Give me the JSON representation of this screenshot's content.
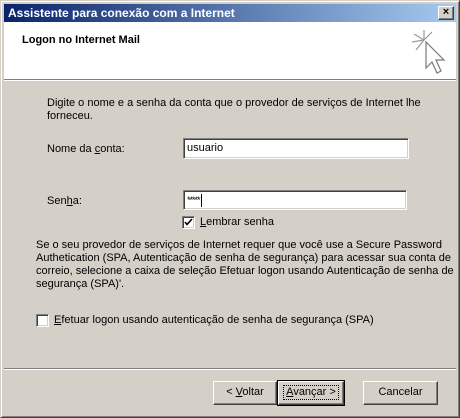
{
  "window": {
    "title": "Assistente para conexão com a Internet",
    "close_label": "×"
  },
  "header": {
    "title": "Logon no Internet Mail",
    "icon": "wizard-cursor-icon"
  },
  "intro_text": "Digite o nome e a senha da conta que o provedor de serviços de Internet lhe forneceu.",
  "account": {
    "label_before": "Nome da ",
    "label_accel": "c",
    "label_after": "onta:",
    "value": "usuario"
  },
  "password": {
    "label_before": "Sen",
    "label_accel": "h",
    "label_after": "a:",
    "mask": "*****"
  },
  "remember": {
    "accel": "L",
    "label_rest": "embrar senha",
    "checked": true
  },
  "spa_description": "Se o seu provedor de serviços de Internet requer que você use a Secure Password Authetication (SPA, Autenticação de senha de segurança) para acessar sua conta de correio, selecione a caixa de seleção Efetuar logon usando Autenticação de senha de segurança (SPA)'.",
  "spa_option": {
    "accel": "E",
    "label_rest": "fetuar logon usando autenticação de senha de segurança (SPA)",
    "checked": false
  },
  "buttons": {
    "back_prefix": "< ",
    "back_accel": "V",
    "back_rest": "oltar",
    "next_accel": "A",
    "next_rest": "vançar >",
    "cancel": "Cancelar"
  }
}
